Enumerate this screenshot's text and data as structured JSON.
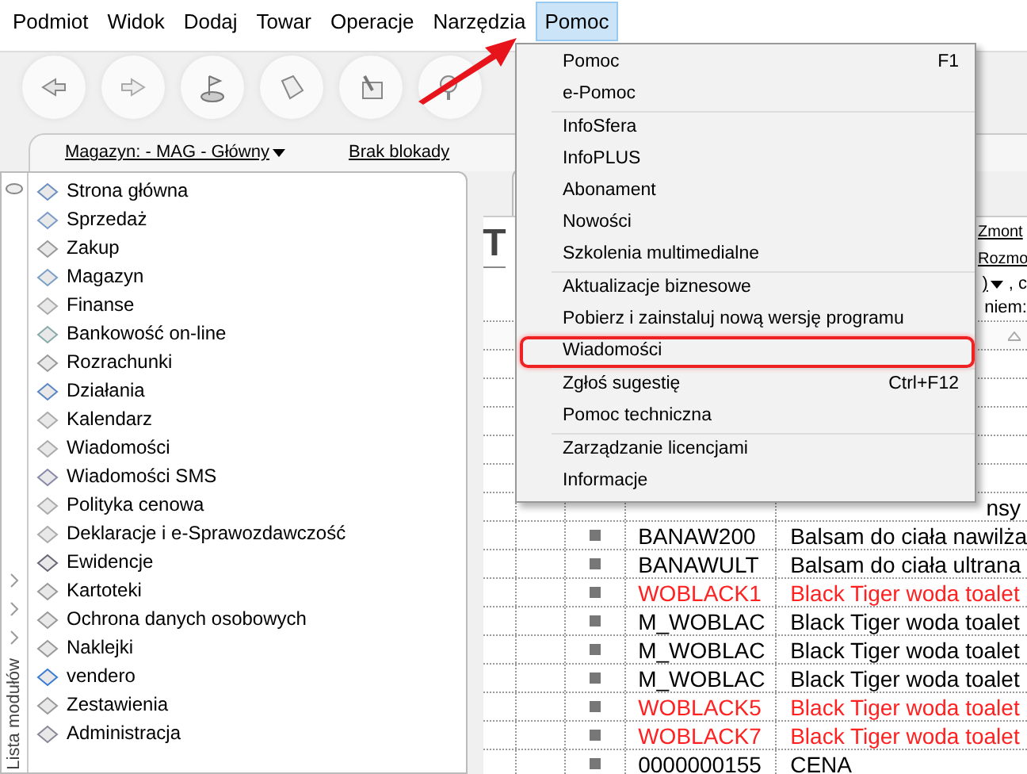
{
  "menu_bar": [
    {
      "label": "Podmiot",
      "selected": false
    },
    {
      "label": "Widok",
      "selected": false
    },
    {
      "label": "Dodaj",
      "selected": false
    },
    {
      "label": "Towar",
      "selected": false
    },
    {
      "label": "Operacje",
      "selected": false
    },
    {
      "label": "Narzędzia",
      "selected": false
    },
    {
      "label": "Pomoc",
      "selected": true
    }
  ],
  "filter_bar": {
    "warehouse": "Magazyn: - MAG - Główny",
    "lock": "Brak blokady"
  },
  "modules": {
    "title": "Lista modułów",
    "items": [
      "Strona główna",
      "Sprzedaż",
      "Zakup",
      "Magazyn",
      "Finanse",
      "Bankowość on-line",
      "Rozrachunki",
      "Działania",
      "Kalendarz",
      "Wiadomości",
      "Wiadomości SMS",
      "Polityka cenowa",
      "Deklaracje i e-Sprawozdawczość",
      "Ewidencje",
      "Kartoteki",
      "Ochrona danych osobowych",
      "Naklejki",
      "vendero",
      "Zestawienia",
      "Administracja"
    ]
  },
  "content": {
    "title": "T",
    "links": [
      "Zmont",
      "Rozmo"
    ],
    "filter_text": ")",
    "filter_suffix": ", c",
    "label": "niem:"
  },
  "table": {
    "rows": [
      {},
      {},
      {},
      {},
      {},
      {
        "name": "nsy"
      },
      {
        "code": "BANAW200",
        "name": "Balsam do ciała nawilża",
        "red": false
      },
      {
        "code": "BANAWULT",
        "name": "Balsam do ciała ultrana",
        "red": false
      },
      {
        "code": "WOBLACK1",
        "name": "Black Tiger woda toalet",
        "red": true
      },
      {
        "code": "M_WOBLAC",
        "name": "Black Tiger woda toalet",
        "red": false
      },
      {
        "code": "M_WOBLAC",
        "name": "Black Tiger woda toalet",
        "red": false
      },
      {
        "code": "M_WOBLAC",
        "name": "Black Tiger woda toalet",
        "red": false
      },
      {
        "code": "WOBLACK5",
        "name": "Black Tiger woda toalet",
        "red": true
      },
      {
        "code": "WOBLACK7",
        "name": "Black Tiger woda toalet",
        "red": true
      },
      {
        "code": "0000000155",
        "name": "CENA",
        "red": false
      }
    ]
  },
  "dropdown": {
    "groups": [
      [
        {
          "label": "Pomoc",
          "shortcut": "F1",
          "highlighted": false
        },
        {
          "label": "e-Pomoc",
          "highlighted": false
        }
      ],
      [
        {
          "label": "InfoSfera",
          "highlighted": false
        },
        {
          "label": "InfoPLUS",
          "highlighted": false
        },
        {
          "label": "Abonament",
          "highlighted": false
        },
        {
          "label": "Nowości",
          "highlighted": false
        },
        {
          "label": "Szkolenia multimedialne",
          "highlighted": false
        }
      ],
      [
        {
          "label": "Aktualizacje biznesowe",
          "highlighted": false
        },
        {
          "label": "Pobierz i zainstaluj nową wersję programu",
          "highlighted": false
        },
        {
          "label": "Wiadomości",
          "highlighted": true
        }
      ],
      [
        {
          "label": "Zgłoś sugestię",
          "shortcut": "Ctrl+F12",
          "highlighted": false
        },
        {
          "label": "Pomoc techniczna",
          "highlighted": false
        }
      ],
      [
        {
          "label": "Zarządzanie licencjami",
          "highlighted": false
        },
        {
          "label": "Informacje",
          "highlighted": false
        }
      ]
    ]
  }
}
